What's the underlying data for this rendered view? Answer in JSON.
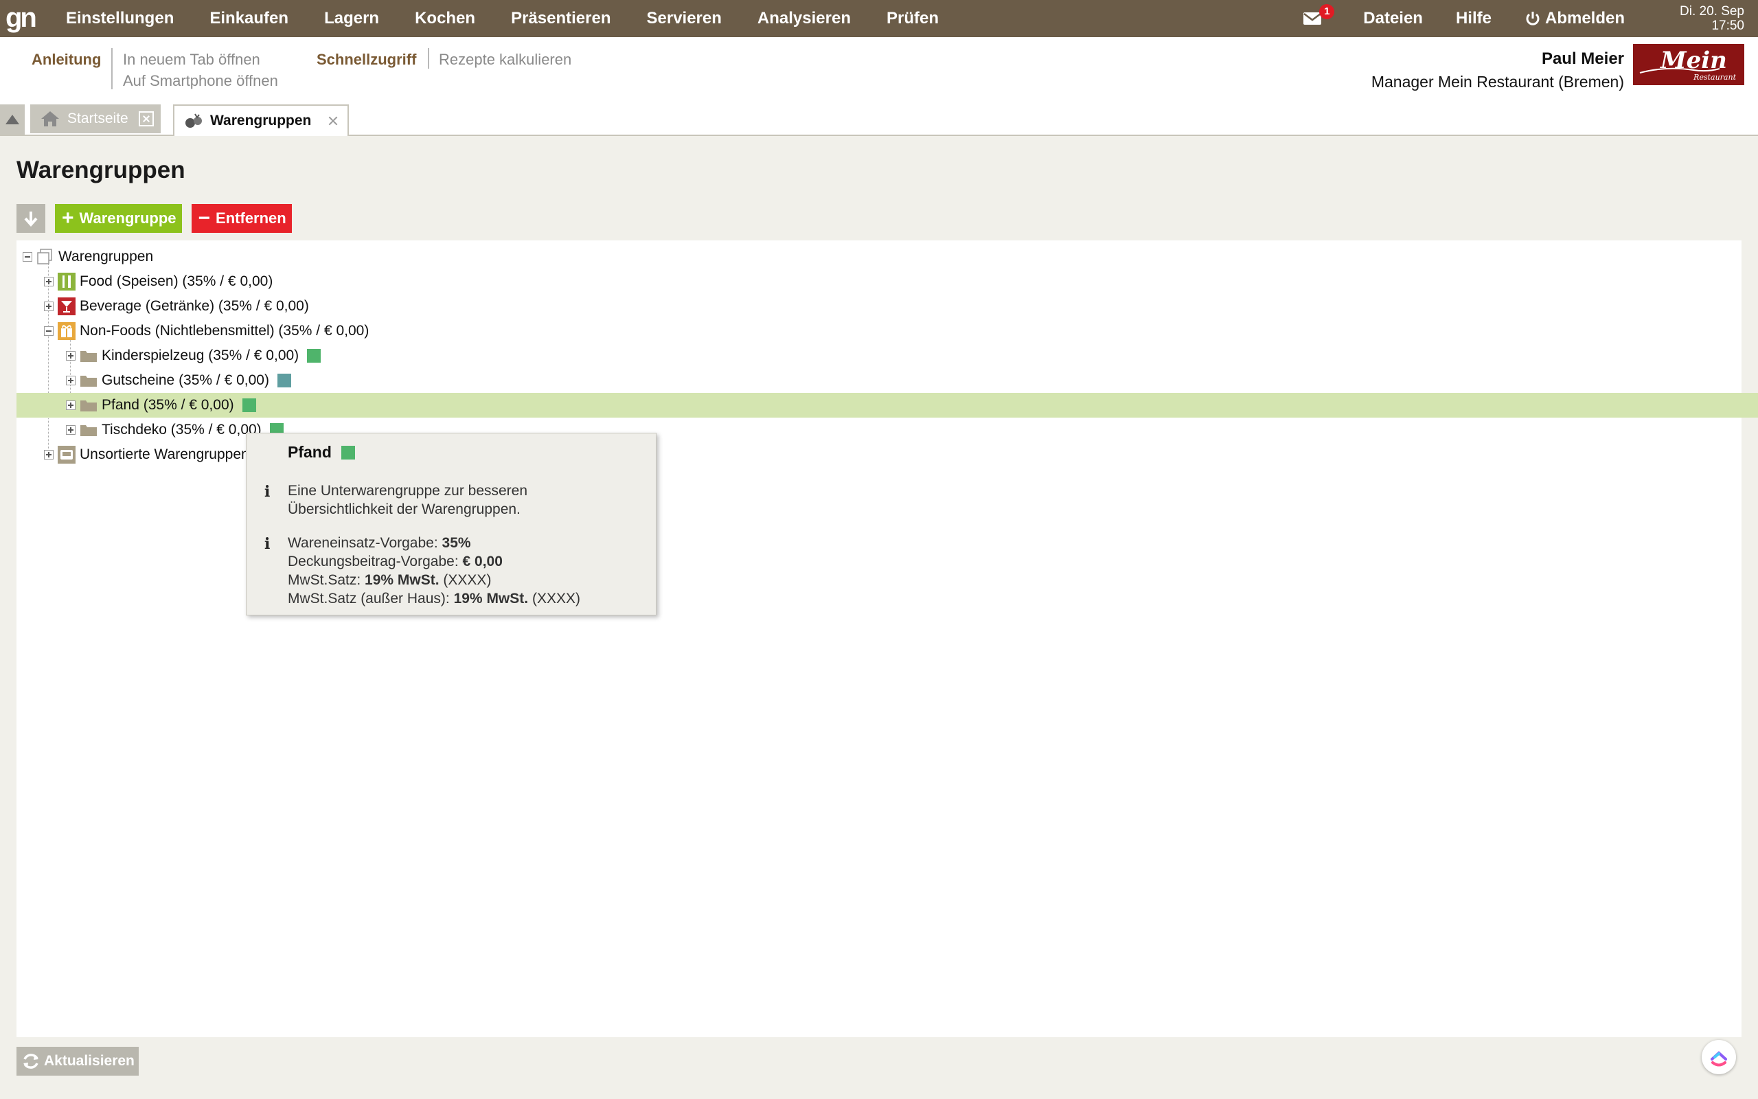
{
  "app": {
    "logo_text": "gn",
    "nav": [
      "Einstellungen",
      "Einkaufen",
      "Lagern",
      "Kochen",
      "Präsentieren",
      "Servieren",
      "Analysieren",
      "Prüfen"
    ],
    "mail_count": "1",
    "files_label": "Dateien",
    "help_label": "Hilfe",
    "logout_label": "Abmelden",
    "date": "Di. 20. Sep",
    "time": "17:50"
  },
  "subheader": {
    "guide_label": "Anleitung",
    "open_new_tab": "In neuem Tab öffnen",
    "open_smartphone": "Auf Smartphone öffnen",
    "quick_access_label": "Schnellzugriff",
    "calc_recipes": "Rezepte kalkulieren",
    "user_name": "Paul Meier",
    "user_role": "Manager Mein Restaurant (Bremen)",
    "brand_name": "Mein",
    "brand_sub": "Restaurant"
  },
  "tabs": [
    {
      "label": "Startseite",
      "active": false
    },
    {
      "label": "Warengruppen",
      "active": true
    }
  ],
  "page": {
    "title": "Warengruppen",
    "add_label": "Warengruppe",
    "remove_label": "Entfernen",
    "refresh_label": "Aktualisieren"
  },
  "tree": {
    "root": "Warengruppen",
    "items": [
      {
        "label": "Food (Speisen) (35% / € 0,00)",
        "icon": "cutlery-icon",
        "color": "#8cb43c"
      },
      {
        "label": "Beverage (Getränke) (35% / € 0,00)",
        "icon": "cocktail-icon",
        "color": "#c0262c"
      },
      {
        "label": "Non-Foods (Nichtlebensmittel) (35% / € 0,00)",
        "icon": "gift-icon",
        "color": "#e8a83c"
      },
      {
        "label": "Kinderspielzeug (35% / € 0,00)",
        "swatch": "#4fb46b"
      },
      {
        "label": "Gutscheine (35% / € 0,00)",
        "swatch": "#5f9ea0"
      },
      {
        "label": "Pfand (35% / € 0,00)",
        "swatch": "#4fb46b"
      },
      {
        "label": "Tischdeko (35% / € 0,00)",
        "swatch": "#4fb46b"
      },
      {
        "label": "Unsortierte Warengruppen",
        "icon": "inbox-icon"
      }
    ]
  },
  "tooltip": {
    "title": "Pfand",
    "swatch": "#4fb46b",
    "desc_line1": "Eine Unterwarengruppe zur besseren",
    "desc_line2": "Übersichtlichkeit der Warengruppen.",
    "wareneinsatz_label": "Wareneinsatz-Vorgabe:",
    "wareneinsatz_value": "35%",
    "deckung_label": "Deckungsbeitrag-Vorgabe:",
    "deckung_value": "€ 0,00",
    "mwst_label": "MwSt.Satz:",
    "mwst_value": "19% MwSt.",
    "mwst_code": "(XXXX)",
    "mwst_out_label": "MwSt.Satz (außer Haus):",
    "mwst_out_value": "19% MwSt.",
    "mwst_out_code": "(XXXX)"
  }
}
